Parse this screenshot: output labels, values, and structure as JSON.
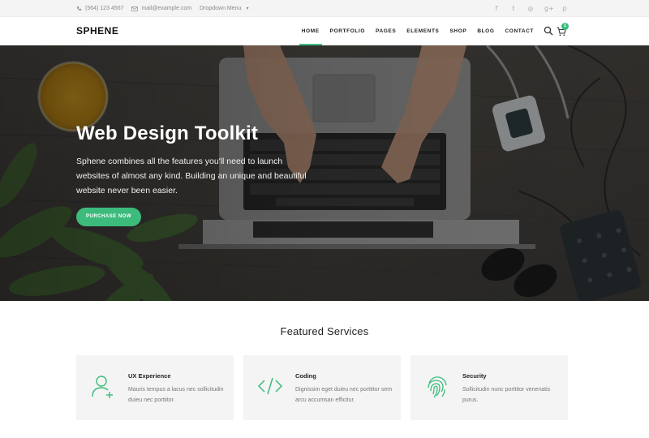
{
  "topbar": {
    "phone": "(564) 123 4567",
    "email": "mail@example.com",
    "dropdown": "Dropdown Menu",
    "social": [
      {
        "icon": "facebook-icon",
        "glyph": "f"
      },
      {
        "icon": "twitter-icon",
        "glyph": "t"
      },
      {
        "icon": "dribbble-icon",
        "glyph": "◎"
      },
      {
        "icon": "google-plus-icon",
        "glyph": "g+"
      },
      {
        "icon": "pinterest-icon",
        "glyph": "p"
      }
    ]
  },
  "header": {
    "logo": "SPHENE",
    "nav": [
      {
        "label": "HOME",
        "active": true
      },
      {
        "label": "PORTFOLIO"
      },
      {
        "label": "PAGES"
      },
      {
        "label": "ELEMENTS"
      },
      {
        "label": "SHOP"
      },
      {
        "label": "BLOG"
      },
      {
        "label": "CONTACT"
      }
    ],
    "cart_count": "1"
  },
  "hero": {
    "title": "Web Design Toolkit",
    "text": "Sphene combines all the features you'll need to launch websites of almost any kind. Building an unique and beautiful website never been easier.",
    "button": "PURCHASE NOW"
  },
  "services": {
    "title": "Featured Services",
    "cards": [
      {
        "icon": "user-add-icon",
        "title": "UX Experience",
        "text": "Mauris tempus a lacus nec sollicitudin duieu nec porttitor."
      },
      {
        "icon": "code-icon",
        "title": "Coding",
        "text": "Dignissim eget duieu nec porttitor sem arcu accumsan efficitur."
      },
      {
        "icon": "fingerprint-icon",
        "title": "Security",
        "text": "Sollicitudin nunc porttitor venenatis purus."
      }
    ]
  },
  "colors": {
    "accent": "#3cbb7c",
    "topbar_bg": "#f4f4f4",
    "card_bg": "#f4f4f4"
  }
}
